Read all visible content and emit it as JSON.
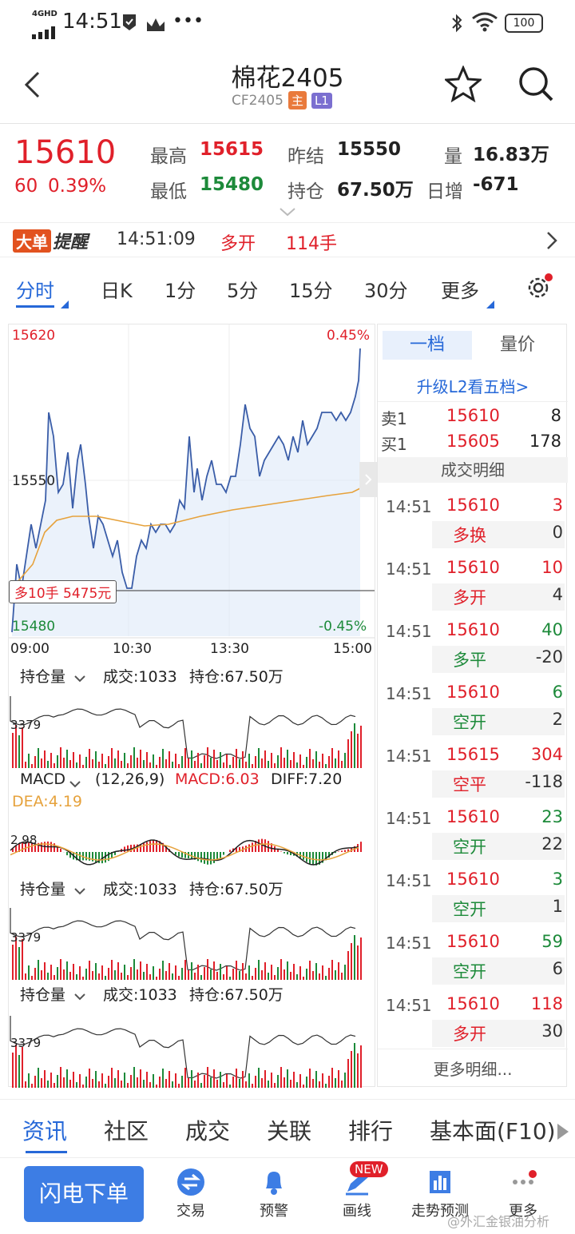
{
  "status_bar": {
    "time": "14:51",
    "network": "4GHD",
    "battery": "100"
  },
  "header": {
    "title": "棉花2405",
    "code": "CF2405",
    "badge_main": "主",
    "badge_l1": "L1"
  },
  "quote": {
    "price": "15610",
    "change": "60",
    "change_pct": "0.39%",
    "high_label": "最高",
    "high": "15615",
    "low_label": "最低",
    "low": "15480",
    "prev_settle_label": "昨结",
    "prev_settle": "15550",
    "open_interest_label": "持仓",
    "open_interest": "67.50万",
    "volume_label": "量",
    "volume": "16.83万",
    "daily_inc_label": "日增",
    "daily_inc": "-671"
  },
  "alert": {
    "tag1": "大单",
    "tag2": "提醒",
    "time": "14:51:09",
    "action": "多开",
    "qty": "114手"
  },
  "period_tabs": [
    "分时",
    "日K",
    "1分",
    "5分",
    "15分",
    "30分",
    "更多"
  ],
  "intraday": {
    "high_price": "15620",
    "high_pct": "0.45%",
    "mid_price": "15550",
    "low_price": "15480",
    "low_pct": "-0.45%",
    "time_axis": [
      "09:00",
      "10:30",
      "13:30",
      "15:00"
    ],
    "tooltip": "多10手  5475元"
  },
  "sub1": {
    "name": "持仓量",
    "vol": "成交:1033",
    "oi": "持仓:67.50万",
    "marker": "3379"
  },
  "macd": {
    "name": "MACD",
    "params": "(12,26,9)",
    "macd": "MACD:6.03",
    "diff": "DIFF:7.20",
    "dea": "DEA:4.19",
    "marker": "2.98"
  },
  "sub2": {
    "name": "持仓量",
    "vol": "成交:1033",
    "oi": "持仓:67.50万",
    "marker": "3379"
  },
  "sub3": {
    "name": "持仓量",
    "vol": "成交:1033",
    "oi": "持仓:67.50万",
    "marker": "3379"
  },
  "orderbook": {
    "tab_level1": "一档",
    "tab_volprice": "量价",
    "upgrade": "升级L2看五档>",
    "ask_label": "卖1",
    "ask_price": "15610",
    "ask_qty": "8",
    "bid_label": "买1",
    "bid_price": "15605",
    "bid_qty": "178",
    "detail_title": "成交明细",
    "trades": [
      {
        "time": "14:51",
        "price": "15610",
        "qty": "3",
        "type": "多换",
        "oi": "0",
        "color": "#e0202a"
      },
      {
        "time": "14:51",
        "price": "15610",
        "qty": "10",
        "type": "多开",
        "oi": "4",
        "color": "#e0202a"
      },
      {
        "time": "14:51",
        "price": "15610",
        "qty": "40",
        "type": "多平",
        "oi": "-20",
        "color": "#1d8a3a"
      },
      {
        "time": "14:51",
        "price": "15610",
        "qty": "6",
        "type": "空开",
        "oi": "2",
        "color": "#1d8a3a"
      },
      {
        "time": "14:51",
        "price": "15615",
        "qty": "304",
        "type": "空平",
        "oi": "-118",
        "color": "#e0202a"
      },
      {
        "time": "14:51",
        "price": "15610",
        "qty": "23",
        "type": "空开",
        "oi": "22",
        "color": "#1d8a3a"
      },
      {
        "time": "14:51",
        "price": "15610",
        "qty": "3",
        "type": "空开",
        "oi": "1",
        "color": "#1d8a3a"
      },
      {
        "time": "14:51",
        "price": "15610",
        "qty": "59",
        "type": "空开",
        "oi": "6",
        "color": "#1d8a3a"
      },
      {
        "time": "14:51",
        "price": "15610",
        "qty": "118",
        "type": "多开",
        "oi": "30",
        "color": "#e0202a"
      }
    ],
    "more": "更多明细..."
  },
  "bottom_tabs": [
    "资讯",
    "社区",
    "成交",
    "关联",
    "排行",
    "基本面(F10)"
  ],
  "toolbar": {
    "flash_order": "闪电下单",
    "trade": "交易",
    "alert": "预警",
    "draw": "画线",
    "new_badge": "NEW",
    "predict": "走势预测",
    "more": "更多"
  },
  "watermark": "@外汇金银油分析"
}
